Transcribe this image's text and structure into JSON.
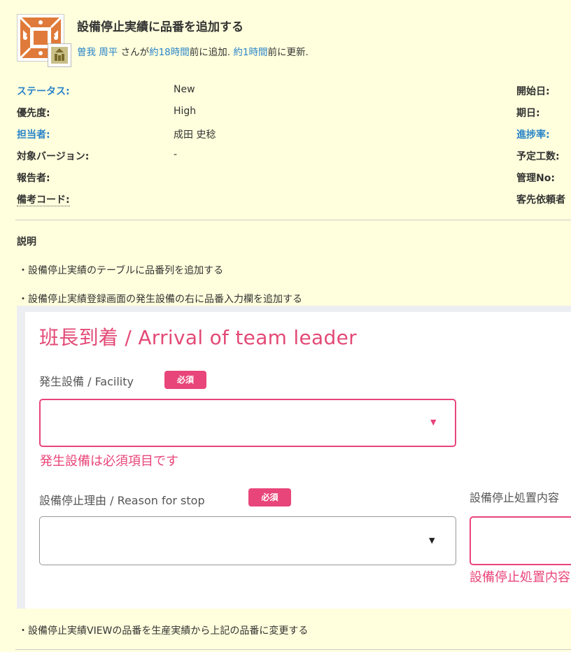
{
  "issue": {
    "title": "設備停止実績に品番を追加する",
    "byline": {
      "author": "曽我 周平",
      "added_suffix_1": " さんが",
      "added_ago": "約18時間",
      "added_suffix_2": "前に追加. ",
      "updated_ago": "約1時間",
      "updated_suffix": "前に更新."
    }
  },
  "attributes": {
    "left": [
      {
        "label": "ステータス:",
        "value": "New"
      },
      {
        "label": "優先度:",
        "value": "High"
      },
      {
        "label": "担当者:",
        "value": "成田 史稔"
      },
      {
        "label": "対象バージョン:",
        "value": "-"
      },
      {
        "label": "報告者:",
        "value": ""
      },
      {
        "label": "備考コード:",
        "value": ""
      }
    ],
    "right": [
      {
        "label": "開始日:"
      },
      {
        "label": "期日:"
      },
      {
        "label": "進捗率:"
      },
      {
        "label": "予定工数:"
      },
      {
        "label": "管理No:"
      },
      {
        "label": "客先依頼者"
      }
    ]
  },
  "description": {
    "title": "説明",
    "lines": [
      "・設備停止実績のテーブルに品番列を追加する",
      "・設備停止実績登録画面の発生設備の右に品番入力欄を追加する",
      "・設備停止実績VIEWの品番を生産実績から上記の品番に変更する"
    ]
  },
  "embedded_form": {
    "title": "班長到着 / Arrival of team leader",
    "required_badge": "必須",
    "facility": {
      "label": "発生設備 / Facility",
      "value": "",
      "error": "発生設備は必須項目です"
    },
    "reason": {
      "label": "設備停止理由 / Reason for stop",
      "value": ""
    },
    "action": {
      "label": "設備停止処置内容",
      "error": "設備停止処置内容は必須項目です"
    }
  },
  "colors": {
    "background": "#ffffdd",
    "link": "#2a84c9",
    "accent": "#e8457a"
  }
}
